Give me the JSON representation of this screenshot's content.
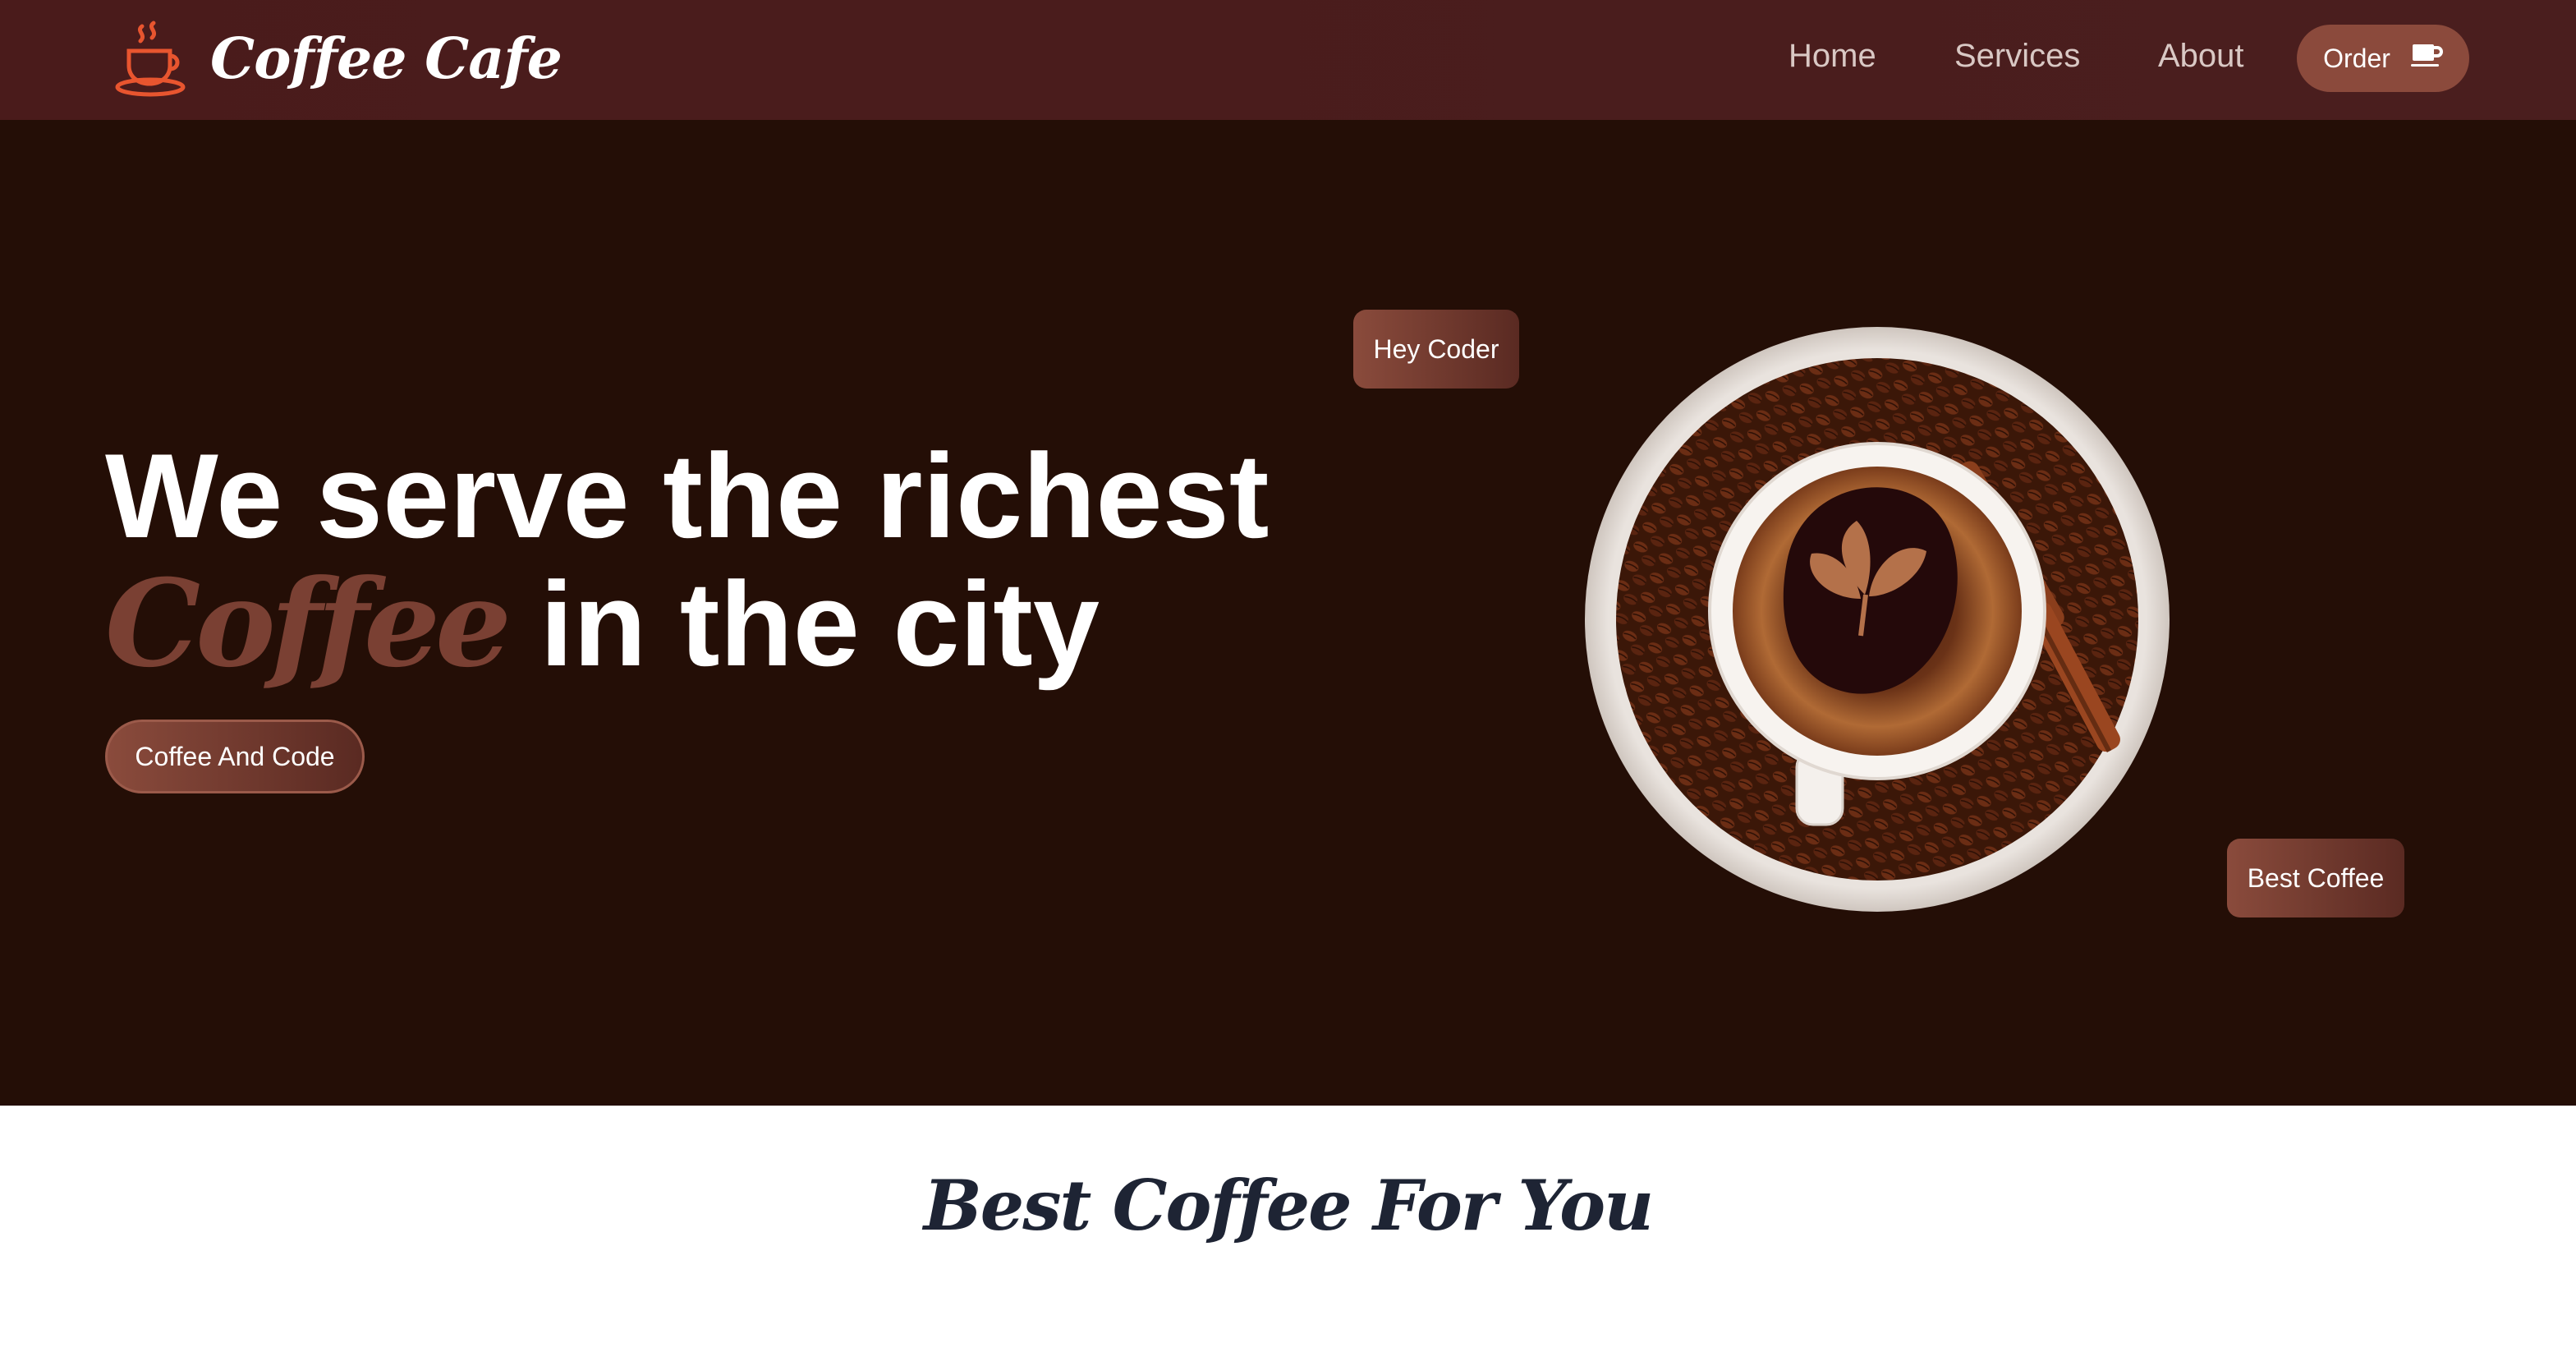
{
  "brand": {
    "name": "Coffee Cafe",
    "icon": "coffee-cup-icon",
    "icon_color": "#e8552f"
  },
  "nav": {
    "links": [
      "Home",
      "Services",
      "About"
    ],
    "order_label": "Order",
    "order_icon": "coffee-mug-icon"
  },
  "hero": {
    "headline_line1": "We serve the richest",
    "headline_highlight": "Coffee",
    "headline_line2_rest": " in the city",
    "cta_label": "Coffee And Code",
    "tag_top": "Hey Coder",
    "tag_bottom": "Best Coffee",
    "image": "coffee-cup-with-beans"
  },
  "section": {
    "title": "Best Coffee For You"
  },
  "colors": {
    "nav_bg": "#4a1b1b",
    "hero_bg": "#240e06",
    "accent": "#8a4b3c",
    "highlight_text": "#7a4033",
    "section_title": "#1e2434"
  }
}
